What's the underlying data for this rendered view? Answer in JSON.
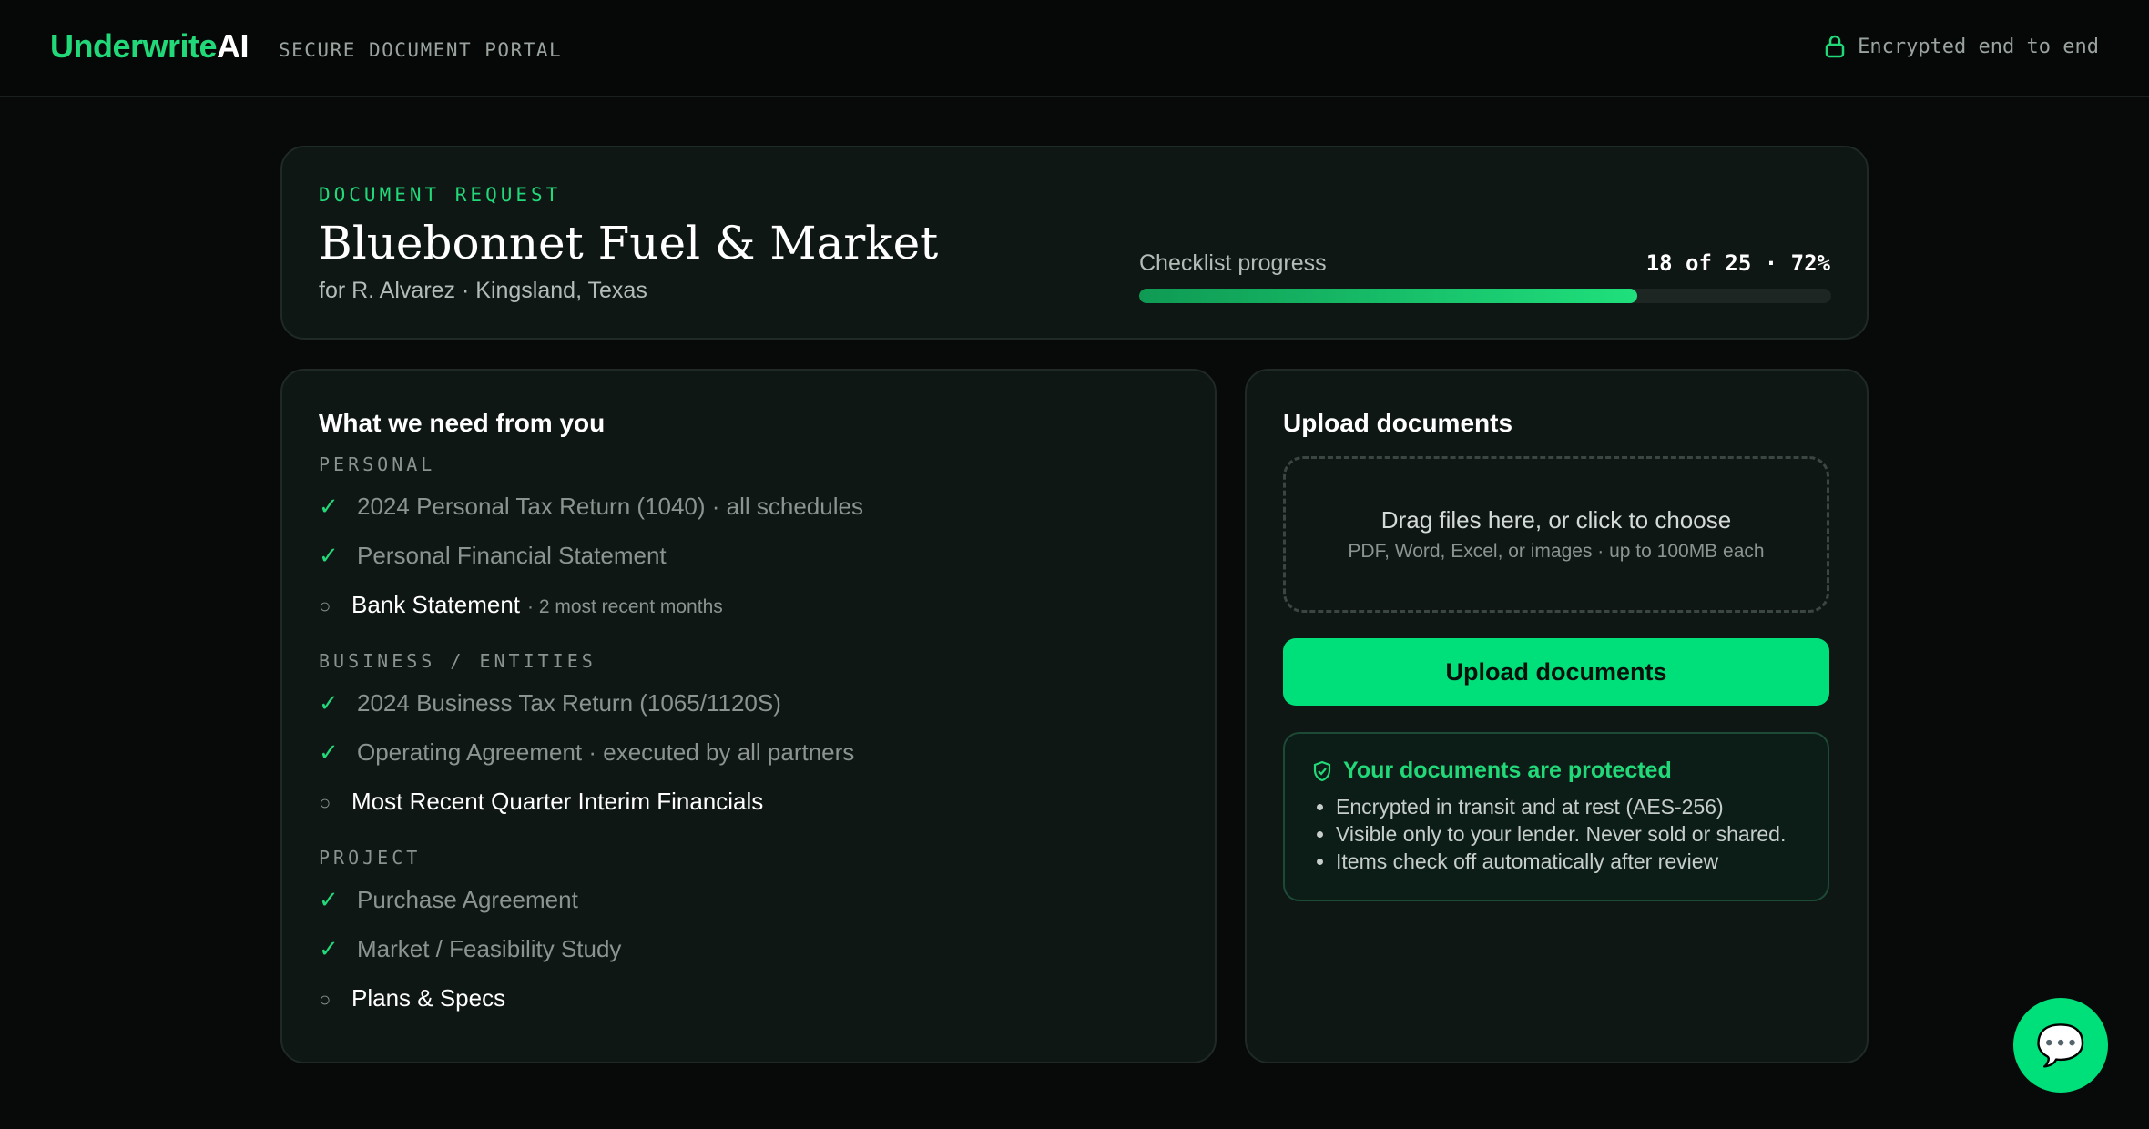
{
  "header": {
    "brand_part1": "Underwrite",
    "brand_part2": "AI",
    "subtitle": "SECURE DOCUMENT PORTAL",
    "security_note": "Encrypted end to end"
  },
  "request": {
    "eyebrow": "DOCUMENT REQUEST",
    "business_name": "Bluebonnet Fuel & Market",
    "subtitle": "for R. Alvarez · Kingsland, Texas",
    "progress_label": "Checklist progress",
    "progress_text": "18 of 25 · 72%",
    "progress_fraction": 0.72
  },
  "checklist": {
    "title": "What we need from you",
    "sections": [
      {
        "label": "PERSONAL",
        "items": [
          {
            "mark": "✓",
            "text": "2024 Personal Tax Return (1040) · all schedules",
            "done": true
          },
          {
            "mark": "✓",
            "text": "Personal Financial Statement",
            "done": true
          },
          {
            "mark": "○",
            "text": "Bank Statement",
            "note": "· 2 most recent months",
            "done": false
          }
        ]
      },
      {
        "label": "BUSINESS / ENTITIES",
        "items": [
          {
            "mark": "✓",
            "text": "2024 Business Tax Return (1065/1120S)",
            "done": true
          },
          {
            "mark": "✓",
            "text": "Operating Agreement · executed by all partners",
            "done": true
          },
          {
            "mark": "○",
            "text": "Most Recent Quarter Interim Financials",
            "done": false
          }
        ]
      },
      {
        "label": "PROJECT",
        "items": [
          {
            "mark": "✓",
            "text": "Purchase Agreement",
            "done": true
          },
          {
            "mark": "✓",
            "text": "Market / Feasibility Study",
            "done": true
          },
          {
            "mark": "○",
            "text": "Plans & Specs",
            "done": false
          }
        ]
      }
    ]
  },
  "upload": {
    "title": "Upload documents",
    "drop_main": "Drag files here, or click to choose",
    "drop_sub": "PDF, Word, Excel, or images · up to 100MB each",
    "button_label": "Upload documents",
    "protect_title": "Your documents are protected",
    "protect_points": [
      "Encrypted in transit and at rest (AES-256)",
      "Visible only to your lender. Never sold or shared.",
      "Items check off automatically after review"
    ]
  },
  "chat": {
    "icon": "💬"
  },
  "colors": {
    "accent": "#22d97a",
    "button": "#00e07a",
    "background": "#070a09",
    "card": "#0f1715"
  }
}
